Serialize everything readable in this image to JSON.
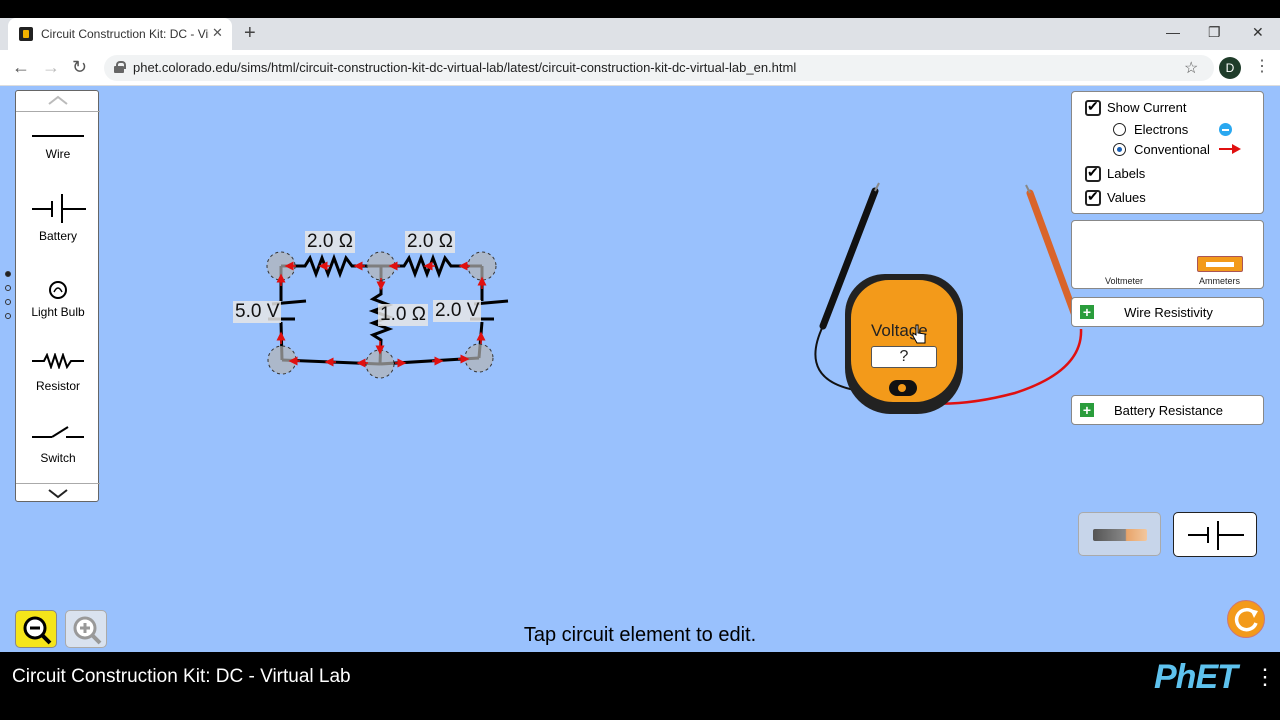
{
  "browser": {
    "tab_title": "Circuit Construction Kit: DC - Virt",
    "tab_close": "✕",
    "new_tab": "+",
    "url": "phet.colorado.edu/sims/html/circuit-construction-kit-dc-virtual-lab/latest/circuit-construction-kit-dc-virtual-lab_en.html",
    "profile_initial": "D",
    "minimize": "—",
    "restore": "❐",
    "close": "✕"
  },
  "toolbox": {
    "items": [
      {
        "label": "Wire"
      },
      {
        "label": "Battery"
      },
      {
        "label": "Light Bulb"
      },
      {
        "label": "Resistor"
      },
      {
        "label": "Switch"
      }
    ]
  },
  "circuit": {
    "labels": {
      "r_top_left": "2.0 Ω",
      "r_top_right": "2.0 Ω",
      "battery_left": "5.0 V",
      "r_middle": "1.0 Ω",
      "battery_right": "2.0 V"
    }
  },
  "voltmeter": {
    "label": "Voltage",
    "reading": "?"
  },
  "show_panel": {
    "show_current": "Show Current",
    "electrons": "Electrons",
    "conventional": "Conventional",
    "labels": "Labels",
    "values": "Values",
    "selected_mode": "Conventional"
  },
  "meters_panel": {
    "voltmeter": "Voltmeter",
    "ammeters": "Ammeters"
  },
  "accordions": {
    "wire_resistivity": "Wire Resistivity",
    "battery_resistance": "Battery Resistance"
  },
  "status": "Tap circuit element to edit.",
  "footer": {
    "title": "Circuit Construction Kit: DC - Virtual Lab",
    "logo": "PhET"
  },
  "colors": {
    "sim_background": "#99c1fd",
    "current_arrow": "#e01010",
    "meter_body": "#f39a1a",
    "zoom_out_active": "#f5e51a",
    "reset": "#f39a1a"
  }
}
